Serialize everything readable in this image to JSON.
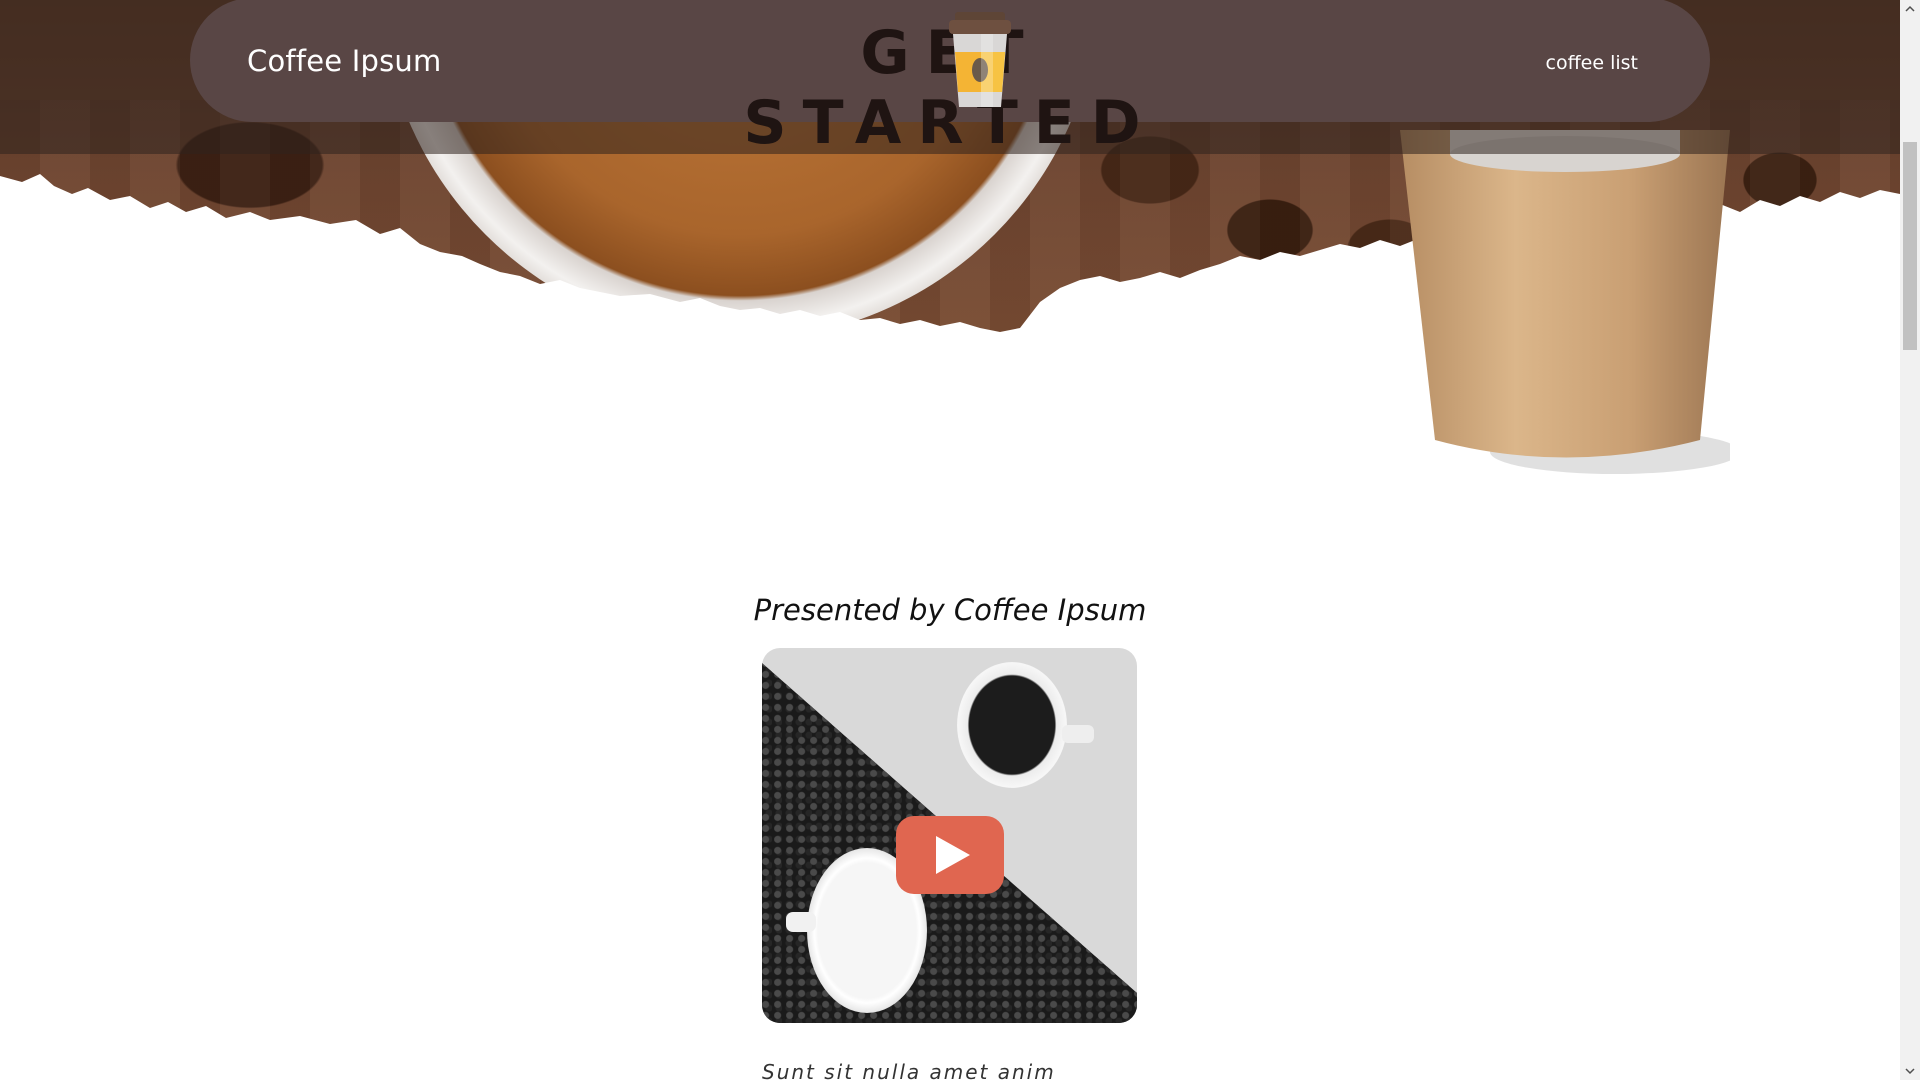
{
  "nav": {
    "brand": "Coffee Ipsum",
    "title": "GET STARTED",
    "link": "coffee list"
  },
  "content": {
    "presented": "Presented by Coffee Ipsum",
    "teaser": "Sunt sit nulla amet anim"
  },
  "colors": {
    "navbar": "#594645",
    "play_button": "#e06650"
  }
}
